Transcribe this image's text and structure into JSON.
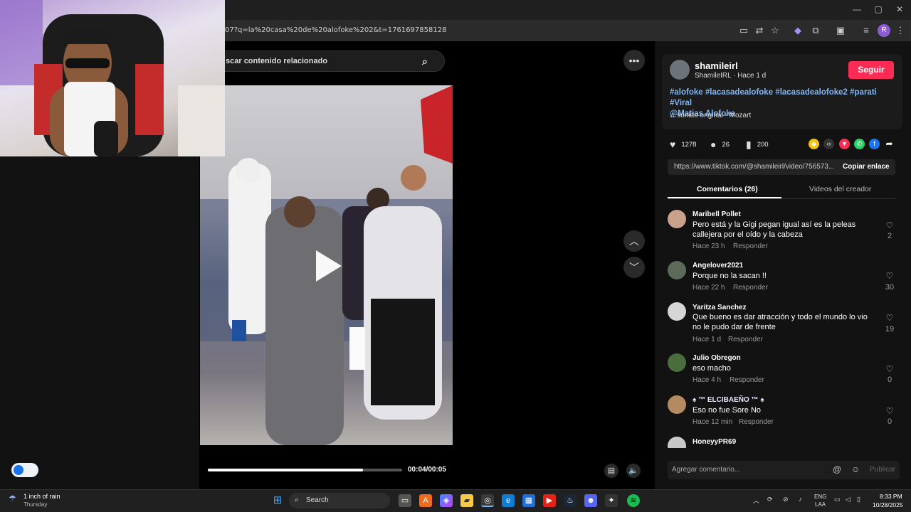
{
  "browser": {
    "url": "07?q=la%20casa%20de%20alofoke%202&t=1761697858128",
    "window_controls": [
      "—",
      "▢",
      "✕"
    ],
    "toolbar_icons": [
      "cast-icon",
      "translate-icon",
      "star-icon",
      "extension-icon",
      "puzzle-icon",
      "sidebar-icon",
      "media-icon",
      "profile-icon",
      "menu-icon"
    ],
    "profile_initial": "R"
  },
  "search": {
    "placeholder": "scar contenido relacionado"
  },
  "video": {
    "time": "00:04/00:05",
    "progress": 0.8
  },
  "creator": {
    "username": "shamileirl",
    "subline": "ShamileIRL · Hace 1 d",
    "follow_label": "Seguir",
    "caption_line1": "#alofoke #lacasadealofoke #lacasadealofoke2 #parati #Viral",
    "caption_line2": "@Matias  Alofoke",
    "sound": "sonido original - Mozart"
  },
  "stats": {
    "likes": "1278",
    "comments": "26",
    "saves": "200"
  },
  "link": {
    "url": "https://www.tiktok.com/@shamileirl/video/756573...",
    "copy_label": "Copiar enlace"
  },
  "tabs": {
    "comments": "Comentarios (26)",
    "creator_videos": "Videos del creador"
  },
  "comments": [
    {
      "name": "Maribell Pollet",
      "text": "Pero está y la Gigi pegan igual así es la peleas callejera por el oído y la cabeza",
      "time": "Hace 23 h",
      "reply": "Responder",
      "likes": "2"
    },
    {
      "name": "Angelover2021",
      "text": "Porque no la sacan !!",
      "time": "Hace 22 h",
      "reply": "Responder",
      "likes": "30"
    },
    {
      "name": "Yaritza Sanchez",
      "text": "Que bueno es dar atracción y todo el mundo lo vio no le pudo dar de frente",
      "time": "Hace 1 d",
      "reply": "Responder",
      "likes": "19"
    },
    {
      "name": "Julio Obregon",
      "text": "eso macho",
      "time": "Hace 4 h",
      "reply": "Responder",
      "likes": "0"
    },
    {
      "name": "♠ ™ ELCIBAEÑO ™ ♠",
      "text": "Eso no fue Sore No",
      "time": "Hace 12 min",
      "reply": "Responder",
      "likes": "0"
    },
    {
      "name": "HoneyyPR69",
      "text": "",
      "time": "",
      "reply": "",
      "likes": ""
    }
  ],
  "composer": {
    "placeholder": "Agregar comentario...",
    "publish": "Publicar"
  },
  "taskbar": {
    "weather_text": "1 inch of rain",
    "weather_day": "Thursday",
    "search_label": "Search",
    "lang1": "ENG",
    "lang2": "LAA",
    "clock_time": "8:33 PM",
    "clock_date": "10/28/2025"
  }
}
